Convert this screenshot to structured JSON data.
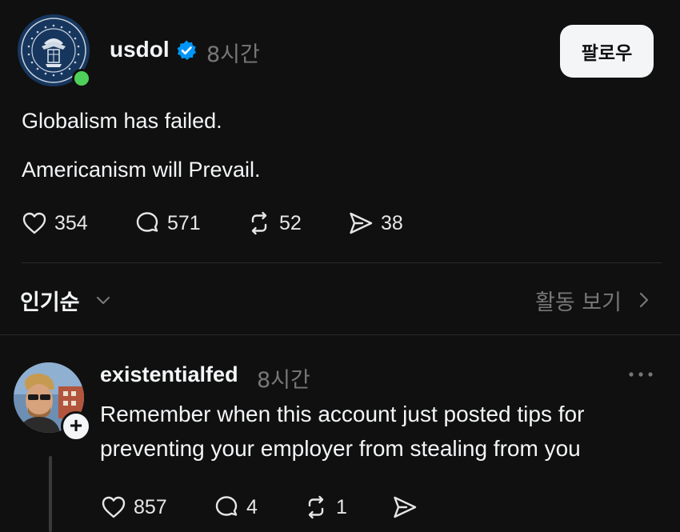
{
  "post": {
    "username": "usdol",
    "time": "8시간",
    "follow_label": "팔로우",
    "lines": [
      "Globalism has failed.",
      "Americanism will Prevail."
    ],
    "actions": {
      "likes": "354",
      "comments": "571",
      "reposts": "52",
      "shares": "38"
    }
  },
  "sort": {
    "label": "인기순",
    "activity_label": "활동 보기"
  },
  "reply": {
    "username": "existentialfed",
    "time": "8시간",
    "lines": [
      "Remember when this account just posted tips for",
      "preventing your employer from stealing from you"
    ],
    "actions": {
      "likes": "857",
      "comments": "4",
      "reposts": "1"
    }
  },
  "colors": {
    "background": "#101010",
    "text": "#f3f5f7",
    "muted": "#777777",
    "verified": "#0095f6",
    "online": "#4fd05a"
  },
  "icons": [
    "dept-of-labor-seal",
    "verified-badge-icon",
    "heart-icon",
    "comment-icon",
    "repost-icon",
    "share-icon",
    "chevron-down-icon",
    "chevron-right-icon",
    "more-icon",
    "plus-icon"
  ]
}
